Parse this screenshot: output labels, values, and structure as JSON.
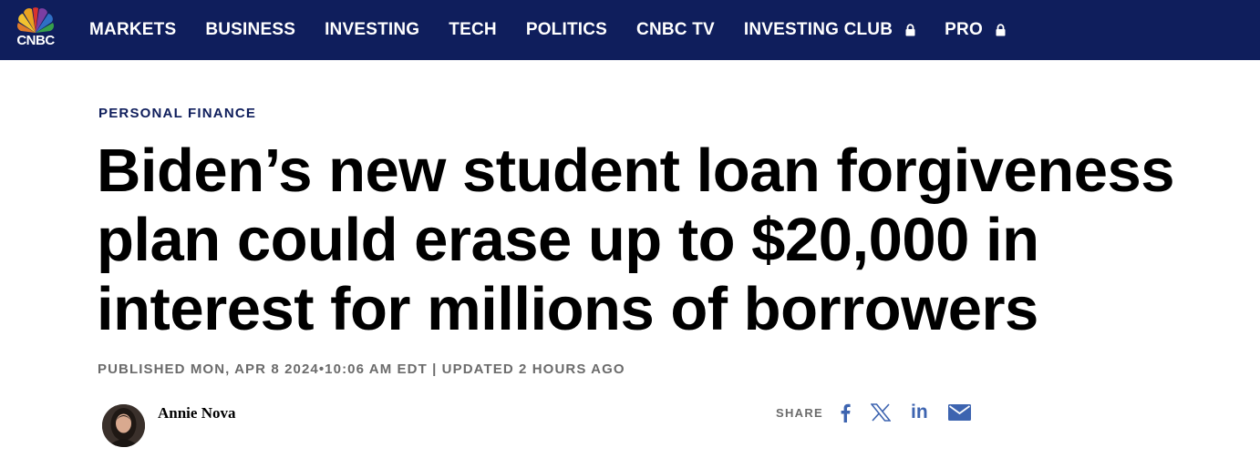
{
  "brand": {
    "logo_text": "CNBC"
  },
  "nav": {
    "items": [
      {
        "label": "MARKETS",
        "locked": false
      },
      {
        "label": "BUSINESS",
        "locked": false
      },
      {
        "label": "INVESTING",
        "locked": false
      },
      {
        "label": "TECH",
        "locked": false
      },
      {
        "label": "POLITICS",
        "locked": false
      },
      {
        "label": "CNBC TV",
        "locked": false
      },
      {
        "label": "INVESTING CLUB",
        "locked": true
      },
      {
        "label": "PRO",
        "locked": true
      }
    ]
  },
  "article": {
    "kicker": "PERSONAL FINANCE",
    "headline": "Biden’s new student loan forgiveness plan could erase up to $20,000 in interest for millions of borrowers",
    "meta": "PUBLISHED MON, APR 8 2024•10:06 AM EDT | UPDATED 2 HOURS AGO",
    "author": "Annie Nova"
  },
  "share": {
    "label": "SHARE",
    "buttons": [
      "facebook-icon",
      "x-icon",
      "linkedin-icon",
      "email-icon"
    ],
    "linkedin_text": "in"
  },
  "colors": {
    "topbar": "#0f1e5c",
    "kicker": "#0f1e5c",
    "meta": "#6b6b6b",
    "share_icon": "#3d64b0"
  }
}
